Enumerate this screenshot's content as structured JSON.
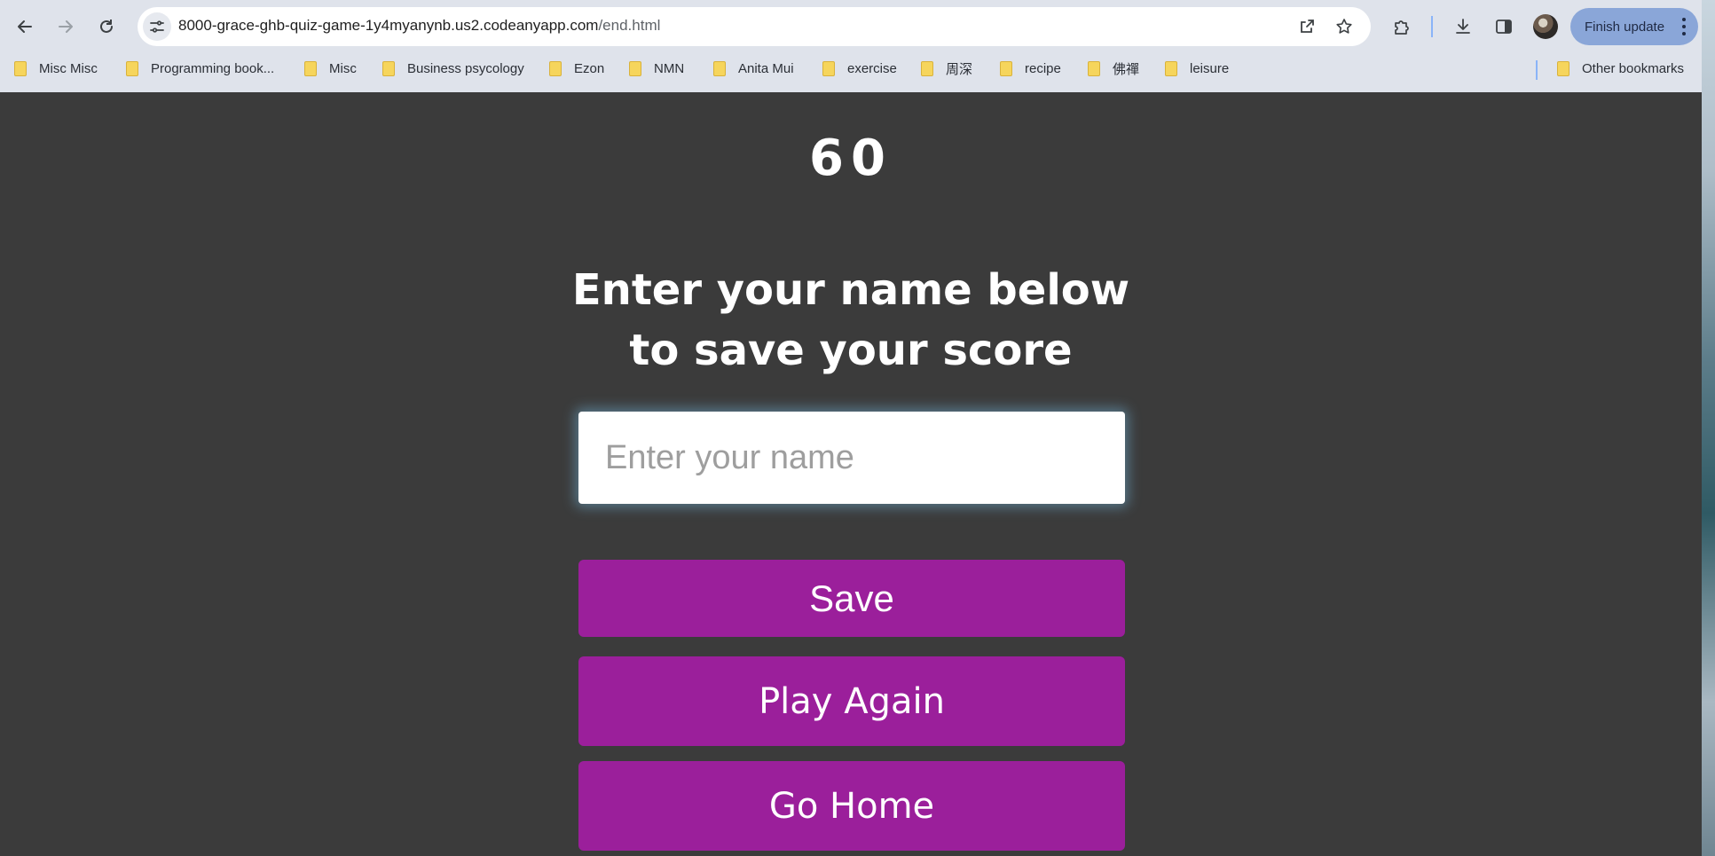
{
  "browser": {
    "url_host": "8000-grace-ghb-quiz-game-1y4myanynb.us2.codeanyapp.com",
    "url_path": "/end.html",
    "update_button_label": "Finish update"
  },
  "bookmarks": [
    "Misc Misc",
    "Programming book...",
    "Misc",
    "Business psycology",
    "Ezon",
    "NMN",
    "Anita Mui",
    "exercise",
    "周深",
    "recipe",
    "佛禪",
    "leisure"
  ],
  "other_bookmarks_label": "Other bookmarks",
  "game": {
    "final_score": "60",
    "prompt_line1": "Enter your name below",
    "prompt_line2": "to save your score",
    "name_placeholder": "Enter your name",
    "name_value": "",
    "save_label": "Save",
    "play_again_label": "Play Again",
    "go_home_label": "Go Home"
  },
  "colors": {
    "page_background": "#3b3b3b",
    "button_purple": "#9b1f9b",
    "update_button": "#8aa6d8"
  }
}
